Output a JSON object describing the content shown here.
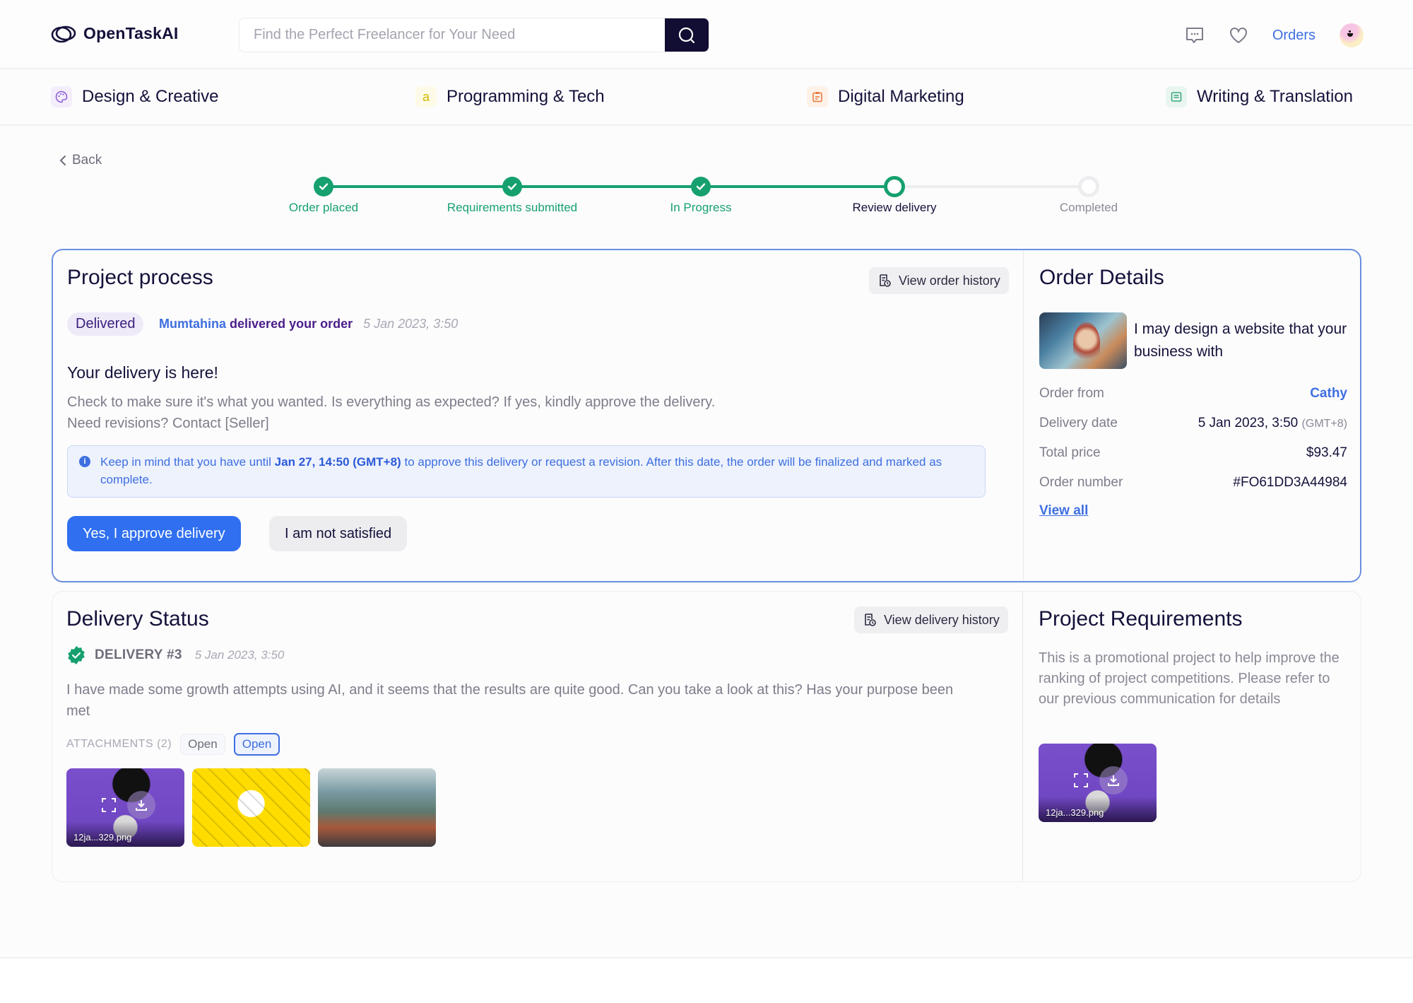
{
  "header": {
    "logo_text": "OpenTaskAI",
    "search_placeholder": "Find the Perfect Freelancer for Your Need",
    "search_value": "",
    "orders_label": "Orders",
    "icons": [
      "message-icon",
      "heart-icon",
      "search-icon",
      "avatar"
    ]
  },
  "categories": [
    {
      "label": "Design & Creative",
      "icon": "palette-icon",
      "color": "#8a5bd6"
    },
    {
      "label": "Programming & Tech",
      "icon": "code-icon",
      "glyph": "a",
      "color": "#d6b800"
    },
    {
      "label": "Digital Marketing",
      "icon": "clipboard-icon",
      "color": "#e8773a"
    },
    {
      "label": "Writing & Translation",
      "icon": "document-icon",
      "color": "#3ba57a"
    }
  ],
  "back_label": "Back",
  "stepper": {
    "steps": [
      {
        "label": "Order placed",
        "state": "done"
      },
      {
        "label": "Requirements submitted",
        "state": "done"
      },
      {
        "label": "In Progress",
        "state": "done"
      },
      {
        "label": "Review delivery",
        "state": "current"
      },
      {
        "label": "Completed",
        "state": "todo"
      }
    ],
    "colors": {
      "done": "#16a06e",
      "current_label": "#14123a",
      "todo": "#8a8a96"
    }
  },
  "project_process": {
    "title": "Project process",
    "history_button": "View order history",
    "status_badge": "Delivered",
    "seller_name": "Mumtahina",
    "delivered_text": "delivered your order",
    "delivered_date": "5 Jan 2023, 3:50",
    "heading": "Your delivery is here!",
    "body_line1": "Check to make sure it's what you wanted. Is everything as expected? If yes, kindly approve the delivery.",
    "body_line2": "Need revisions? Contact [Seller]",
    "info_prefix": "Keep in mind that you have until",
    "info_deadline": "Jan 27, 14:50 (GMT+8)",
    "info_suffix": "to approve this delivery or request a revision. After this date, the order will be finalized and marked as complete.",
    "approve_button": "Yes, I approve delivery",
    "reject_button": "I am not satisfied"
  },
  "order_details": {
    "title": "Order Details",
    "gig_title": "I may design a website that your business with",
    "rows": [
      {
        "key": "Order from",
        "value": "Cathy",
        "is_link": true
      },
      {
        "key": "Delivery date",
        "value": "5 Jan 2023, 3:50",
        "suffix": "(GMT+8)"
      },
      {
        "key": "Total price",
        "value": "$93.47"
      },
      {
        "key": "Order number",
        "value": "#FO61DD3A44984"
      }
    ],
    "view_all": "View all"
  },
  "delivery_status": {
    "title": "Delivery Status",
    "history_button": "View delivery history",
    "delivery_label": "DELIVERY #3",
    "delivery_date": "5 Jan 2023, 3:50",
    "message": "I have made some growth attempts using AI, and it seems that the results are quite good. Can you take a look at this? Has your purpose been met",
    "attachments_label": "ATTACHMENTS (2)",
    "open_chips": [
      "Open",
      "Open"
    ],
    "attachments": [
      {
        "filename": "12ja...329.png",
        "style": "purple"
      },
      {
        "filename": "",
        "style": "yellow"
      },
      {
        "filename": "",
        "style": "city"
      }
    ]
  },
  "project_requirements": {
    "title": "Project Requirements",
    "text": "This is a promotional project to help improve the ranking of project competitions. Please refer to our previous communication for details",
    "attachment": {
      "filename": "12ja...329.png"
    }
  }
}
